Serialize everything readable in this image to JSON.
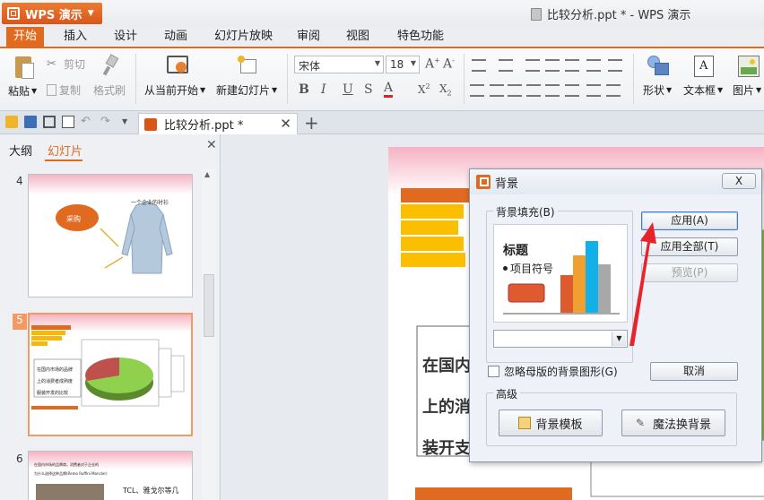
{
  "app": {
    "name": "WPS 演示",
    "window_title": "比较分析.ppt * - WPS 演示"
  },
  "menu": {
    "tabs": [
      "开始",
      "插入",
      "设计",
      "动画",
      "幻灯片放映",
      "审阅",
      "视图",
      "特色功能"
    ],
    "active": "开始"
  },
  "ribbon": {
    "paste": "粘贴",
    "cut": "剪切",
    "copy": "复制",
    "format_painter": "格式刷",
    "from_current": "从当前开始",
    "new_slide": "新建幻灯片",
    "font_name": "宋体",
    "font_size": "18",
    "shape": "形状",
    "textbox": "文本框",
    "picture": "图片"
  },
  "doc_tab": {
    "title": "比较分析.ppt *"
  },
  "panel": {
    "tab_outline": "大纲",
    "tab_slides": "幻灯片",
    "slide_numbers": [
      "4",
      "5",
      "6"
    ],
    "thumb4_title": "一个企业的衬衫",
    "thumb4_oval": "采购",
    "thumb5_text": [
      "在国内市场的品牌",
      "上的消费者成熟度",
      "服装开发的比较"
    ],
    "thumb6_line1": "在国内市场的品牌商，消费者对于企业的",
    "thumb6_line2": "为什么选择这种品牌(Remo Ruffini Moncler)",
    "thumb6_caption": "TCL、雅戈尔等几"
  },
  "slide": {
    "lines": [
      "在国内",
      "上的消",
      "装开支"
    ]
  },
  "dialog": {
    "title": "背景",
    "close": "X",
    "fill_label": "背景填充(B)",
    "preview_title": "标题",
    "preview_bullet": "项目符号",
    "apply": "应用(A)",
    "apply_all": "应用全部(T)",
    "preview_btn": "预览(P)",
    "ignore_master": "忽略母版的背景图形(G)",
    "cancel": "取消",
    "advanced": "高级",
    "bg_template": "背景模板",
    "magic_bg": "魔法换背景"
  },
  "colors": {
    "accent": "#e06a20",
    "focus": "#3d7bd4",
    "arrow": "#e8232a"
  }
}
